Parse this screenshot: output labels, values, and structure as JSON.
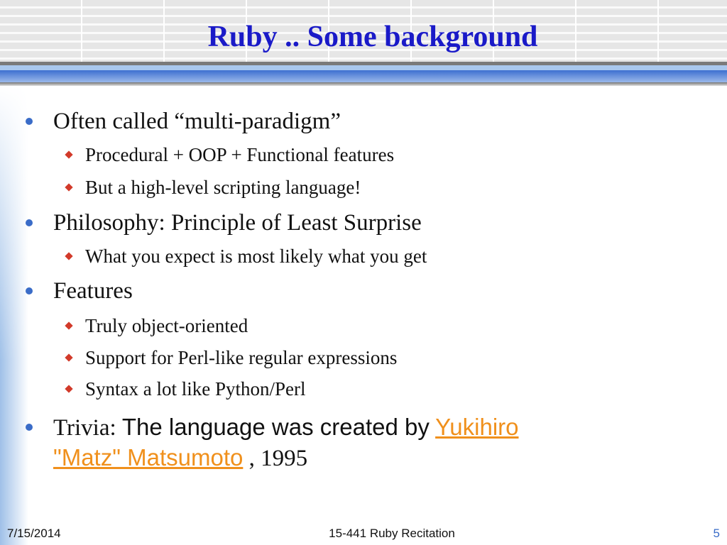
{
  "slide": {
    "title": "Ruby .. Some background",
    "bullets": [
      {
        "text": "Often called “multi-paradigm”"
      },
      {
        "text": "Procedural + OOP + Functional features"
      },
      {
        "text": "But a high-level scripting language!"
      },
      {
        "text": "Philosophy: Principle of Least Surprise"
      },
      {
        "text": "What you expect is most likely what you get"
      },
      {
        "text": "Features"
      },
      {
        "text": "Truly object-oriented"
      },
      {
        "text": "Support for Perl-like regular expressions"
      },
      {
        "text": "Syntax a lot like Python/Perl"
      }
    ],
    "trivia": {
      "label": "Trivia:",
      "text": "The language was created by",
      "link_line1": "Yukihiro",
      "link_line2": "\"Matz\" Matsumoto",
      "suffix": ", 1995"
    }
  },
  "footer": {
    "date": "7/15/2014",
    "center": "15-441 Ruby Recitation",
    "page": "5"
  },
  "colors": {
    "title": "#1a1ac8",
    "link": "#f0901c",
    "bullet": "#3a6cc8",
    "subbullet": "#d23a2a"
  }
}
